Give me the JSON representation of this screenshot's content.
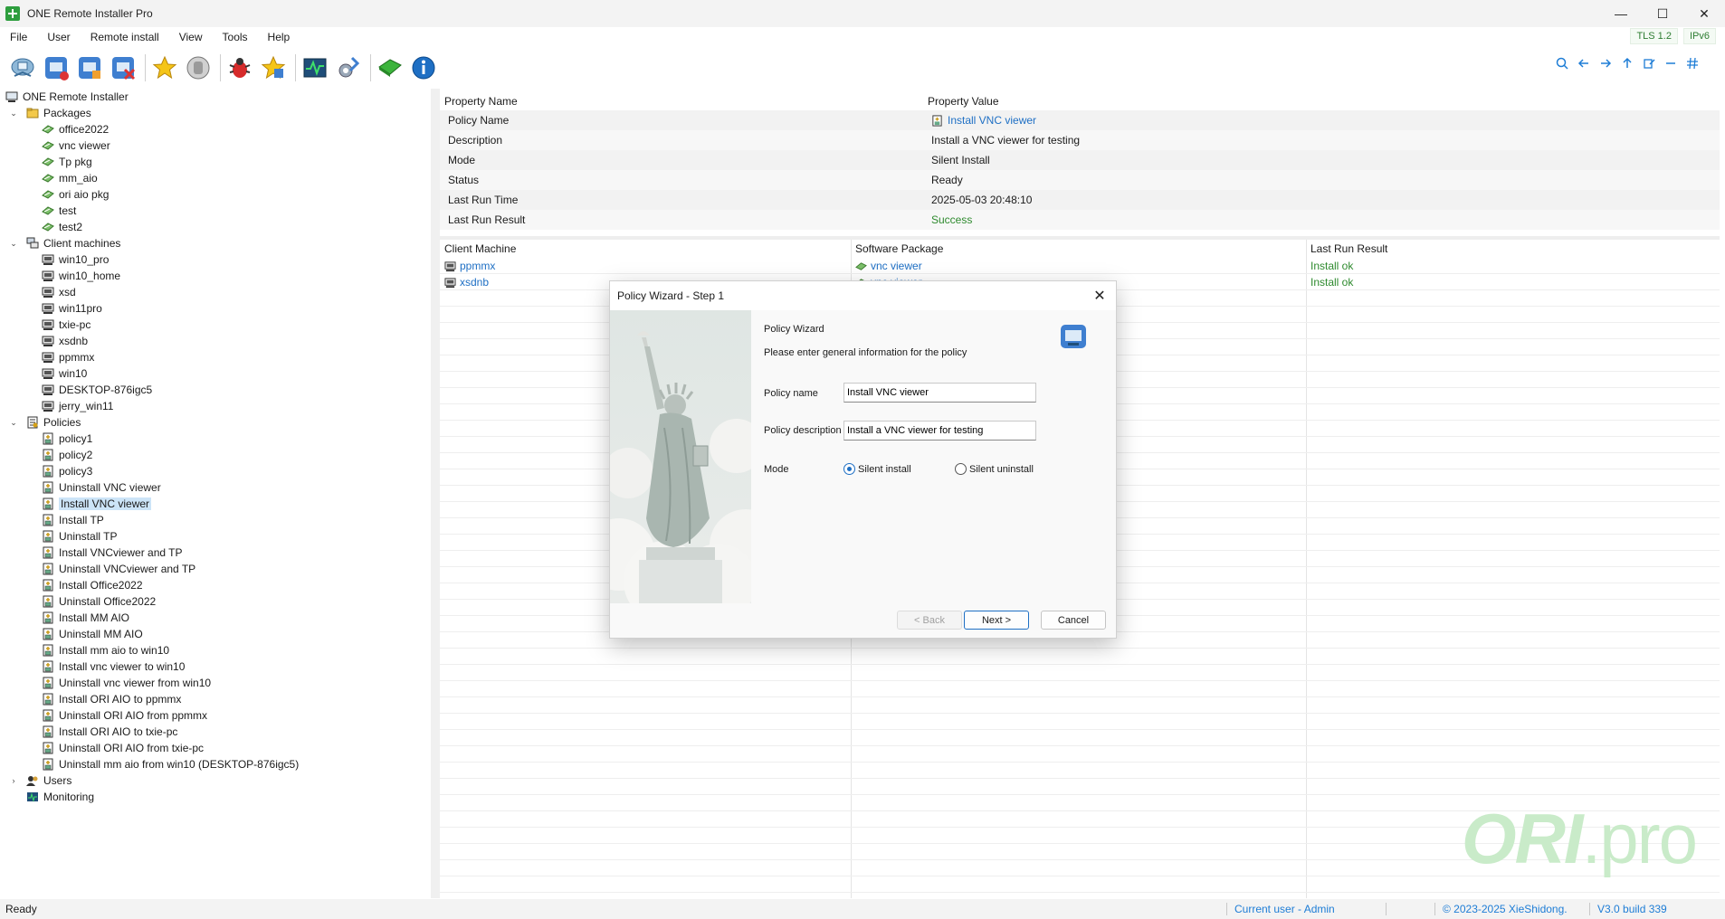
{
  "window": {
    "title": "ONE Remote Installer Pro",
    "minimize": "—",
    "maximize": "☐",
    "close": "✕"
  },
  "menu": {
    "items": [
      "File",
      "User",
      "Remote install",
      "View",
      "Tools",
      "Help"
    ]
  },
  "badges": {
    "tls": "TLS 1.2",
    "ipv": "IPv6"
  },
  "toolbar": {
    "buttons": [
      "connect-icon",
      "add-client-icon",
      "client-properties-icon",
      "delete-client-icon",
      "favorite-icon",
      "stop-icon",
      "bug-icon",
      "star-new-icon",
      "monitor-icon",
      "settings-icon",
      "package-icon",
      "info-icon"
    ],
    "right_icons": [
      "search-icon",
      "arrow-left-icon",
      "arrow-right-icon",
      "arrow-up-icon",
      "edit-icon",
      "minus-icon",
      "hash-icon"
    ]
  },
  "tree": {
    "root": "ONE Remote Installer",
    "packages": {
      "label": "Packages",
      "items": [
        "office2022",
        "vnc viewer",
        "Tp pkg",
        "mm_aio",
        "ori aio pkg",
        "test",
        "test2"
      ]
    },
    "clients": {
      "label": "Client machines",
      "items": [
        "win10_pro",
        "win10_home",
        "xsd",
        "win11pro",
        "txie-pc",
        "xsdnb",
        "ppmmx",
        "win10",
        "DESKTOP-876igc5",
        "jerry_win11"
      ]
    },
    "policies": {
      "label": "Policies",
      "selected": "Install VNC viewer",
      "items": [
        "policy1",
        "policy2",
        "policy3",
        "Uninstall VNC viewer",
        "Install VNC viewer",
        "Install TP",
        "Uninstall TP",
        "Install VNCviewer and TP",
        "Uninstall VNCviewer and TP",
        "Install Office2022",
        "Uninstall Office2022",
        "Install MM AIO",
        "Uninstall MM AIO",
        "Install mm aio to win10",
        "Install vnc viewer to win10",
        "Uninstall vnc viewer from win10",
        "Install ORI AIO to ppmmx",
        "Uninstall ORI AIO from ppmmx",
        "Install ORI AIO to txie-pc",
        "Uninstall ORI AIO from txie-pc",
        "Uninstall mm aio from win10 (DESKTOP-876igc5)"
      ]
    },
    "users": "Users",
    "monitoring": "Monitoring"
  },
  "properties": {
    "header": {
      "name": "Property Name",
      "value": "Property Value"
    },
    "rows": [
      {
        "name": "Policy Name",
        "value": "Install VNC viewer"
      },
      {
        "name": "Description",
        "value": "Install a VNC viewer for testing"
      },
      {
        "name": "Mode",
        "value": "Silent Install"
      },
      {
        "name": "Status",
        "value": "Ready"
      },
      {
        "name": "Last Run Time",
        "value": "2025-05-03 20:48:10"
      },
      {
        "name": "Last Run Result",
        "value": "Success"
      }
    ]
  },
  "grid": {
    "columns": [
      "Client Machine",
      "Software Package",
      "Last Run Result"
    ],
    "rows": [
      {
        "client": "ppmmx",
        "package": "vnc viewer",
        "result": "Install ok"
      },
      {
        "client": "xsdnb",
        "package": "vnc viewer",
        "result": "Install ok"
      }
    ]
  },
  "watermark": {
    "brand": "ORI",
    "suffix": ".pro"
  },
  "status": {
    "ready": "Ready",
    "user": "Current user - Admin",
    "copyright": "© 2023-2025 XieShidong.",
    "version": "V3.0 build 339"
  },
  "dialog": {
    "title": "Policy Wizard - Step 1",
    "heading": "Policy Wizard",
    "subheading": "Please enter general information for the policy",
    "policy_name_label": "Policy name",
    "policy_name_value": "Install VNC viewer",
    "policy_desc_label": "Policy description",
    "policy_desc_value": "Install a VNC viewer for testing",
    "mode_label": "Mode",
    "mode_options": [
      "Silent install",
      "Silent uninstall"
    ],
    "mode_selected": "Silent install",
    "back": "< Back",
    "next": "Next >",
    "cancel": "Cancel"
  },
  "colors": {
    "link": "#1e6fc4",
    "success": "#2e8a2e",
    "selection": "#cce4f7",
    "watermark": "#c9ebc9"
  }
}
